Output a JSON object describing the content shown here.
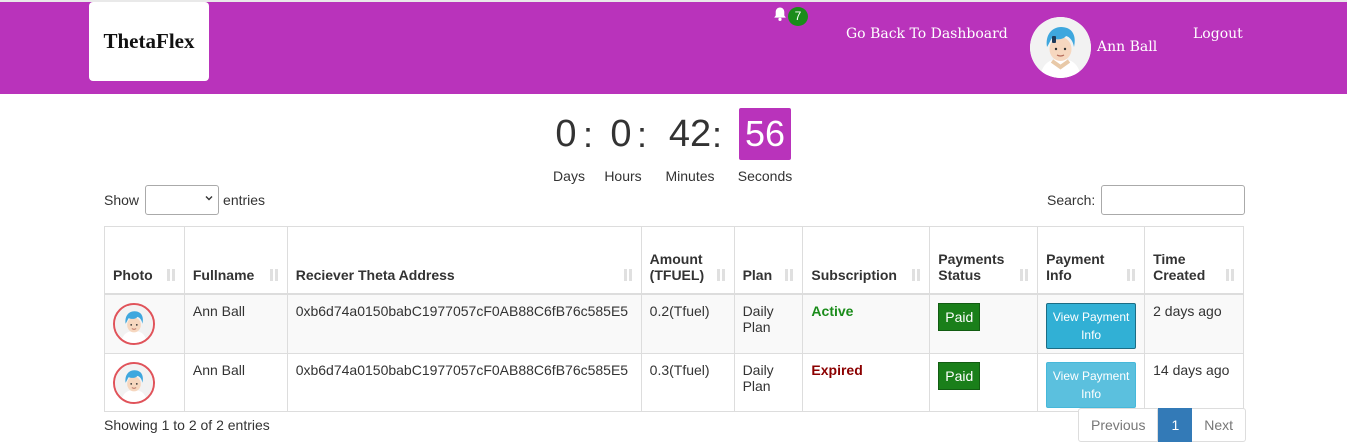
{
  "brand": {
    "logo": "ThetaFlex",
    "accent": "#b933bb"
  },
  "header": {
    "notification_icon": "bell-icon",
    "notification_count": "7",
    "dashboard_link": "Go Back To Dashboard",
    "user_name": "Ann Ball",
    "logout_link": "Logout"
  },
  "countdown": {
    "days": {
      "value": "0",
      "label": "Days"
    },
    "hours": {
      "value": "0",
      "label": "Hours"
    },
    "minutes": {
      "value": "42",
      "label": "Minutes"
    },
    "seconds": {
      "value": "56",
      "label": "Seconds"
    },
    "separator": ":"
  },
  "table_controls": {
    "show_label": "Show",
    "entries_label": "entries",
    "page_size_value": "",
    "search_label": "Search:",
    "search_value": ""
  },
  "table": {
    "columns": [
      {
        "line1": "Photo",
        "line2": ""
      },
      {
        "line1": "Fullname",
        "line2": ""
      },
      {
        "line1": "Reciever Theta Address",
        "line2": ""
      },
      {
        "line1": "Amount",
        "line2": "(TFUEL)"
      },
      {
        "line1": "Plan",
        "line2": ""
      },
      {
        "line1": "Subscription",
        "line2": ""
      },
      {
        "line1": "Payments",
        "line2": "Status"
      },
      {
        "line1": "Payment",
        "line2": "Info"
      },
      {
        "line1": "Time",
        "line2": "Created"
      }
    ],
    "rows": [
      {
        "fullname": "Ann Ball",
        "address": "0xb6d74a0150babC1977057cF0AB88C6fB76c585E5",
        "amount": "0.2(Tfuel)",
        "plan_line1": "Daily",
        "plan_line2": "Plan",
        "subscription": "Active",
        "payment_status": "Paid",
        "payment_info_line1": "View Payment",
        "payment_info_line2": "Info",
        "time_created": "2 days ago"
      },
      {
        "fullname": "Ann Ball",
        "address": "0xb6d74a0150babC1977057cF0AB88C6fB76c585E5",
        "amount": "0.3(Tfuel)",
        "plan_line1": "Daily",
        "plan_line2": "Plan",
        "subscription": "Expired",
        "payment_status": "Paid",
        "payment_info_line1": "View Payment",
        "payment_info_line2": "Info",
        "time_created": "14 days ago"
      }
    ]
  },
  "footer": {
    "info": "Showing 1 to 2 of 2 entries",
    "previous": "Previous",
    "current_page": "1",
    "next": "Next"
  }
}
